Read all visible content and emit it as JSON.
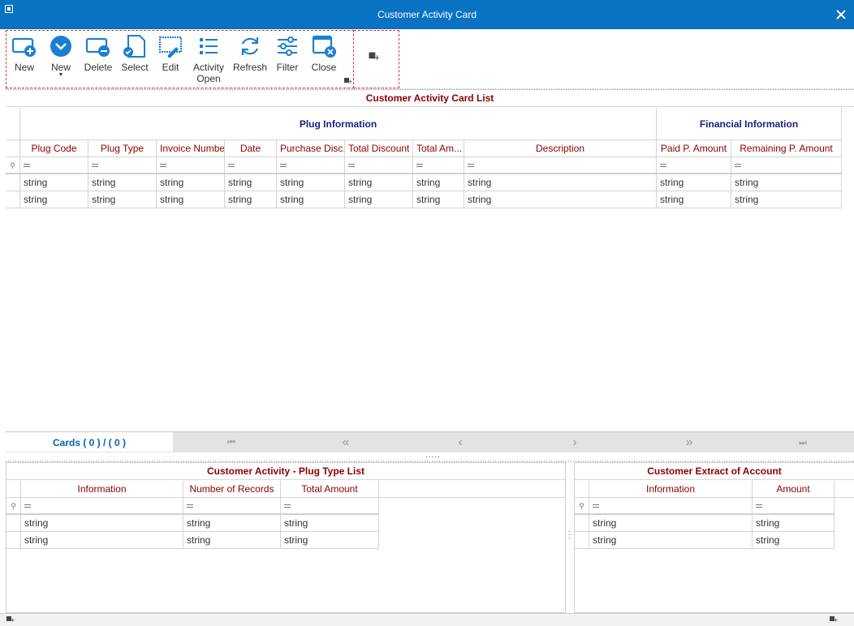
{
  "window": {
    "title": "Customer Activity Card"
  },
  "toolbar": {
    "buttons": [
      {
        "label": "New"
      },
      {
        "label": "New"
      },
      {
        "label": "Delete"
      },
      {
        "label": "Select"
      },
      {
        "label": "Edit"
      },
      {
        "label": "Activity\nOpen"
      },
      {
        "label": "Refresh"
      },
      {
        "label": "Filter"
      },
      {
        "label": "Close"
      }
    ]
  },
  "main_grid": {
    "caption": "Customer Activity Card List",
    "bands": {
      "plug": "Plug Information",
      "financial": "Financial Information"
    },
    "columns": [
      "Plug Code",
      "Plug Type",
      "Invoice Number",
      "Date",
      "Purchase Disc...",
      "Total Discount",
      "Total Am...",
      "Description",
      "Paid P. Amount",
      "Remaining P. Amount"
    ],
    "rows": [
      [
        "string",
        "string",
        "string",
        "string",
        "string",
        "string",
        "string",
        "string",
        "string",
        "string"
      ],
      [
        "string",
        "string",
        "string",
        "string",
        "string",
        "string",
        "string",
        "string",
        "string",
        "string"
      ]
    ]
  },
  "navigator": {
    "counter": "Cards ( 0 ) / ( 0 )"
  },
  "plug_type_grid": {
    "caption": "Customer Activity - Plug Type List",
    "columns": [
      "Information",
      "Number of Records",
      "Total Amount"
    ],
    "rows": [
      [
        "string",
        "string",
        "string"
      ],
      [
        "string",
        "string",
        "string"
      ]
    ]
  },
  "extract_grid": {
    "caption": "Customer Extract of Account",
    "columns": [
      "Information",
      "Amount"
    ],
    "rows": [
      [
        "string",
        "string"
      ],
      [
        "string",
        "string"
      ]
    ]
  },
  "colors": {
    "titlebar": "#0a72c2",
    "icon_blue": "#1a7fd4",
    "header_text": "#8b0000",
    "band_text": "#1a237e",
    "accent_dash": "#e0323c"
  }
}
